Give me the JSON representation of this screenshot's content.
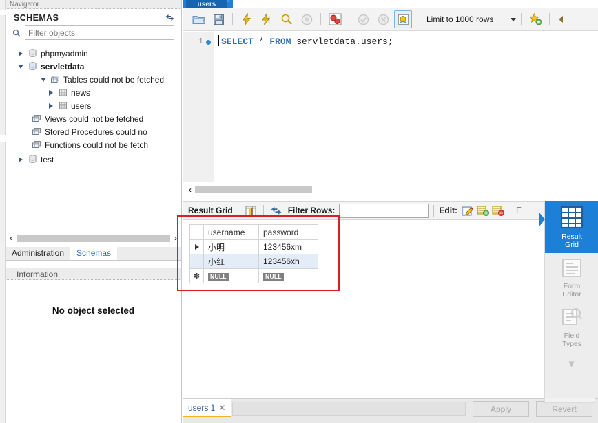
{
  "window": {
    "navigator_caption": "Navigator"
  },
  "sidebar": {
    "header": {
      "title": "SCHEMAS",
      "refresh_icon": "refresh-icon"
    },
    "filter": {
      "placeholder": "Filter objects",
      "value": "",
      "icon": "search-icon"
    },
    "tree": [
      {
        "label": "phpmyadmin",
        "icon": "database-icon",
        "expanded": false,
        "level": 0,
        "bold": false
      },
      {
        "label": "servletdata",
        "icon": "database-icon",
        "expanded": true,
        "level": 0,
        "bold": true
      },
      {
        "label": "Tables could not be fetched",
        "icon": "folder-tables-icon",
        "expanded": true,
        "level": 1,
        "bold": false
      },
      {
        "label": "news",
        "icon": "table-icon",
        "expanded": false,
        "level": 2,
        "bold": false
      },
      {
        "label": "users",
        "icon": "table-icon",
        "expanded": false,
        "level": 2,
        "bold": false
      },
      {
        "label": "Views could not be fetched",
        "icon": "folder-views-icon",
        "expanded": null,
        "level": 1,
        "bold": false
      },
      {
        "label": "Stored Procedures could no",
        "icon": "folder-procedures-icon",
        "expanded": null,
        "level": 1,
        "bold": false
      },
      {
        "label": "Functions could not be fetch",
        "icon": "folder-functions-icon",
        "expanded": null,
        "level": 1,
        "bold": false
      },
      {
        "label": "test",
        "icon": "database-icon",
        "expanded": false,
        "level": 0,
        "bold": false
      }
    ],
    "scroll": {
      "left_arrow": "‹",
      "right_arrow": "›"
    },
    "tabs": [
      {
        "label": "Administration",
        "active": false
      },
      {
        "label": "Schemas",
        "active": true
      }
    ],
    "information_label": "Information",
    "no_object_text": "No object selected"
  },
  "main": {
    "document_tab": {
      "label": "users",
      "chevron": "⌃"
    },
    "toolbar": {
      "buttons": [
        {
          "name": "open-sql-file-button",
          "icon": "folder-open-icon"
        },
        {
          "name": "save-sql-file-button",
          "icon": "floppy-save-icon"
        },
        {
          "name": "execute-statement-button",
          "icon": "lightning-icon"
        },
        {
          "name": "execute-current-statement-button",
          "icon": "lightning-cursor-icon"
        },
        {
          "name": "explain-statement-button",
          "icon": "magnifier-icon"
        },
        {
          "name": "stop-statement-button",
          "icon": "stop-circle-icon"
        },
        {
          "name": "toggle-explain-button",
          "icon": "gears-icon"
        },
        {
          "name": "commit-button",
          "icon": "check-circle-icon"
        },
        {
          "name": "rollback-button",
          "icon": "cancel-circle-icon"
        },
        {
          "name": "toggle-autocommit-button",
          "icon": "autocommit-icon"
        }
      ],
      "limit_label": "Limit to 1000 rows",
      "snippet_icon": "star-plus-icon",
      "overflow_icon": "toolbar-overflow-icon"
    },
    "editor": {
      "line_number": "1",
      "sql_tokens": [
        {
          "text": "SELECT",
          "type": "keyword"
        },
        {
          "text": " * ",
          "type": "plain"
        },
        {
          "text": "FROM",
          "type": "keyword"
        },
        {
          "text": " servletdata.users;",
          "type": "plain"
        }
      ],
      "sql_full": "SELECT * FROM servletdata.users;"
    },
    "result_toolbar": {
      "result_grid_label": "Result Grid",
      "grid_icon": "grid-columns-icon",
      "refresh_icon": "refresh-blue-icon",
      "filter_rows_label": "Filter Rows:",
      "filter_rows_value": "",
      "edit_label": "Edit:",
      "edit_icons": [
        "edit-pencil-icon",
        "insert-row-icon",
        "delete-row-icon"
      ],
      "export_label_partial": "E"
    },
    "grid": {
      "columns": [
        "",
        "username",
        "password"
      ],
      "rows": [
        {
          "marker": "current",
          "username": "小明",
          "password": "123456xm",
          "selected": false
        },
        {
          "marker": "",
          "username": "小红",
          "password": "123456xh",
          "selected": true
        },
        {
          "marker": "new",
          "username": "NULL",
          "password": "NULL",
          "selected": false
        }
      ],
      "null_badge_text": "NULL"
    },
    "right_strip": {
      "items": [
        {
          "label_line1": "Result",
          "label_line2": "Grid",
          "icon": "result-grid-icon",
          "active": true
        },
        {
          "label_line1": "Form",
          "label_line2": "Editor",
          "icon": "form-editor-icon",
          "active": false
        },
        {
          "label_line1": "Field",
          "label_line2": "Types",
          "icon": "field-types-icon",
          "active": false
        }
      ],
      "more_icon": "chevron-down-icon"
    },
    "bottom": {
      "tab_label": "users 1",
      "tab_close_icon": "close-icon",
      "cell_value": "",
      "apply_label": "Apply",
      "revert_label": "Revert"
    }
  },
  "annotation": {
    "highlight_color": "#d61f26"
  },
  "colors": {
    "accent_blue": "#1d7fd6",
    "keyword_blue": "#2b6fb5",
    "selection_blue": "#e3ecf7",
    "toolbar_bg": "#f3f3f3"
  }
}
